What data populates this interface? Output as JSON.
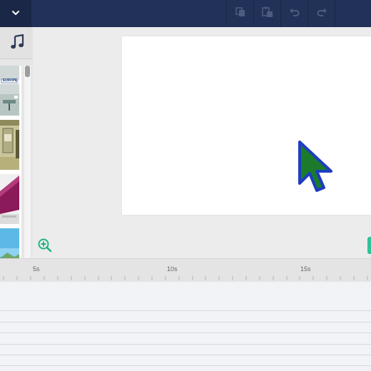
{
  "toolbar": {
    "dropdown_icon": "chevron-down-icon",
    "icons": [
      "copy-icon",
      "paste-icon",
      "undo-icon",
      "redo-icon"
    ]
  },
  "left_panel": {
    "active_tab_icon": "music-note-icon",
    "thumbnails": [
      {
        "caption": "EUROPE"
      },
      {
        "caption": ""
      },
      {
        "caption": ""
      },
      {
        "caption": ""
      }
    ]
  },
  "timeline": {
    "ruler_labels": [
      "5s",
      "10s",
      "15s"
    ]
  },
  "colors": {
    "topbar": "#223158",
    "accent": "#2fc29a",
    "cursor_fill": "#1a7a2a",
    "cursor_outline": "#1f3fbf"
  }
}
